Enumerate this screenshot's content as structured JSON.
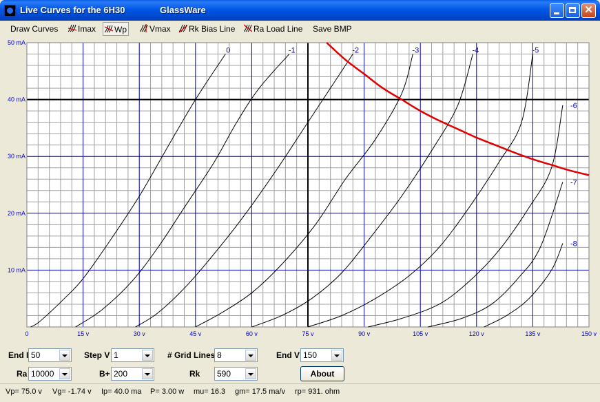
{
  "window": {
    "title": "Live Curves for the 6H30",
    "brand": "GlassWare"
  },
  "menu": {
    "draw_curves": "Draw Curves",
    "imax": "Imax",
    "wp": "Wp",
    "vmax": "Vmax",
    "rk_bias_line": "Rk Bias Line",
    "ra_load_line": "Ra Load Line",
    "save_bmp": "Save BMP"
  },
  "controls": {
    "end_i_label": "End I",
    "end_i_value": "50",
    "step_v_label": "Step V",
    "step_v_value": "1",
    "grid_lines_label": "# Grid Lines",
    "grid_lines_value": "8",
    "end_v_label": "End V",
    "end_v_value": "150",
    "ra_label": "Ra",
    "ra_value": "10000",
    "bplus_label": "B+",
    "bplus_value": "200",
    "rk_label": "Rk",
    "rk_value": "590",
    "about_label": "About"
  },
  "status": {
    "vp": "Vp= 75.0 v",
    "vg": "Vg= -1.74 v",
    "ip": "Ip= 40.0 ma",
    "p": "P= 3.00 w",
    "mu": "mu= 16.3",
    "gm": "gm= 17.5 ma/v",
    "rp": "rp= 931. ohm"
  },
  "colors": {
    "major_grid": "#0000C0",
    "minor_grid": "#A0A0A0",
    "curve": "#000000",
    "wp_curve": "#E00000",
    "label": "#0000C0"
  },
  "chart_data": {
    "type": "line",
    "xlim": [
      0,
      150
    ],
    "ylim": [
      0,
      50
    ],
    "x_ticks": [
      "0",
      "15 v",
      "30 v",
      "45 v",
      "60 v",
      "75 v",
      "90 v",
      "105 v",
      "120 v",
      "135 v",
      "150 v"
    ],
    "y_ticks": [
      "10 mA",
      "20 mA",
      "30 mA",
      "40 mA",
      "50 mA"
    ],
    "grid": true,
    "series": [
      {
        "name": "0",
        "points": [
          [
            1,
            0
          ],
          [
            3.5,
            1
          ],
          [
            10,
            5
          ],
          [
            15,
            8.5
          ],
          [
            22,
            15
          ],
          [
            30,
            23
          ],
          [
            37,
            31
          ],
          [
            45,
            40
          ],
          [
            53,
            48
          ]
        ]
      },
      {
        "name": "-1",
        "points": [
          [
            13,
            0
          ],
          [
            20,
            3
          ],
          [
            28,
            8
          ],
          [
            35,
            14
          ],
          [
            42,
            21
          ],
          [
            50,
            29
          ],
          [
            56,
            36
          ],
          [
            62,
            42
          ],
          [
            70,
            48
          ]
        ]
      },
      {
        "name": "-2",
        "points": [
          [
            29,
            0
          ],
          [
            35,
            2.5
          ],
          [
            43,
            7.5
          ],
          [
            52,
            14.5
          ],
          [
            59,
            20.5
          ],
          [
            67,
            28
          ],
          [
            74,
            35
          ],
          [
            80,
            41
          ],
          [
            87,
            48
          ]
        ]
      },
      {
        "name": "-3",
        "points": [
          [
            45,
            0
          ],
          [
            52,
            2.5
          ],
          [
            60,
            6
          ],
          [
            68,
            11
          ],
          [
            77,
            18
          ],
          [
            85,
            26
          ],
          [
            93,
            33
          ],
          [
            100,
            41
          ],
          [
            103,
            48
          ]
        ]
      },
      {
        "name": "-4",
        "points": [
          [
            60,
            0
          ],
          [
            68,
            2
          ],
          [
            76,
            5
          ],
          [
            84,
            9.5
          ],
          [
            92,
            16
          ],
          [
            100,
            23
          ],
          [
            108,
            31
          ],
          [
            115,
            39
          ],
          [
            119,
            48
          ]
        ]
      },
      {
        "name": "-5",
        "points": [
          [
            75,
            0
          ],
          [
            84,
            2
          ],
          [
            93,
            5
          ],
          [
            102,
            9
          ],
          [
            110,
            14
          ],
          [
            118,
            21
          ],
          [
            126,
            29
          ],
          [
            132,
            36
          ],
          [
            135,
            48
          ]
        ]
      },
      {
        "name": "-6",
        "points": [
          [
            91,
            0
          ],
          [
            100,
            1.5
          ],
          [
            110,
            4
          ],
          [
            118,
            8
          ],
          [
            126,
            13.5
          ],
          [
            134,
            21
          ],
          [
            140,
            28
          ],
          [
            143,
            39
          ]
        ]
      },
      {
        "name": "-7",
        "points": [
          [
            107,
            0
          ],
          [
            116,
            1.5
          ],
          [
            124,
            4
          ],
          [
            131,
            8.5
          ],
          [
            137,
            14
          ],
          [
            143,
            25.5
          ]
        ]
      },
      {
        "name": "-8",
        "points": [
          [
            122,
            0
          ],
          [
            128,
            2
          ],
          [
            134,
            5
          ],
          [
            140,
            10
          ],
          [
            143,
            14.7
          ]
        ]
      }
    ],
    "wp_curve": {
      "name": "Wp",
      "points": [
        [
          80,
          50
        ],
        [
          85,
          47
        ],
        [
          90,
          44.5
        ],
        [
          95,
          42
        ],
        [
          100,
          40
        ],
        [
          105,
          38
        ],
        [
          110,
          36.3
        ],
        [
          115,
          34.8
        ],
        [
          120,
          33.3
        ],
        [
          125,
          32
        ],
        [
          130,
          30.7
        ],
        [
          135,
          29.5
        ],
        [
          140,
          28.5
        ],
        [
          145,
          27.5
        ],
        [
          150,
          26.7
        ]
      ]
    },
    "crosshair": {
      "x": 75,
      "y": 40
    }
  }
}
